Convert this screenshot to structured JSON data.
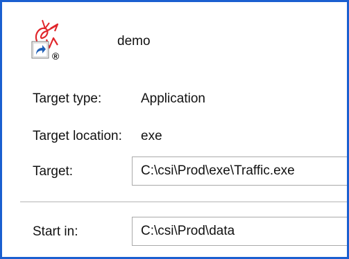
{
  "shortcut": {
    "name": "demo",
    "icon": "traffic-app-shortcut-icon",
    "registered_mark": "®"
  },
  "properties": {
    "target_type_label": "Target type:",
    "target_type_value": "Application",
    "target_location_label": "Target location:",
    "target_location_value": "exe",
    "target_label": "Target:",
    "target_value": "C:\\csi\\Prod\\exe\\Traffic.exe",
    "start_in_label": "Start in:",
    "start_in_value": "C:\\csi\\Prod\\data"
  },
  "colors": {
    "frame_border": "#1a5fd0",
    "logo_red": "#e0262b",
    "shortcut_arrow_blue": "#1f5fb6"
  }
}
